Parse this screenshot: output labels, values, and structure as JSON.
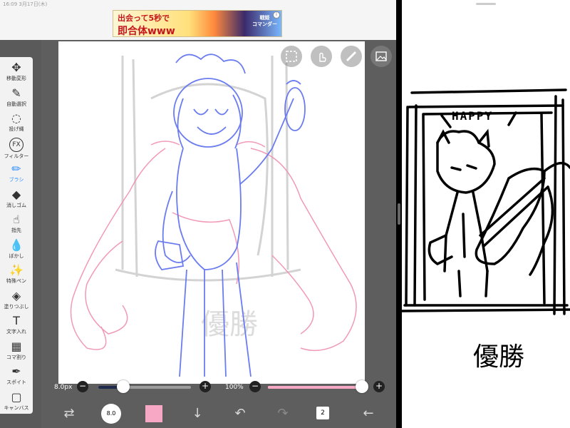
{
  "statusbar": {
    "time": "16:09  3月17日(木)"
  },
  "ad": {
    "line1": "出会って5秒で",
    "line2": "即合体www",
    "logo": "戦姫\nコマンダー",
    "info": "i"
  },
  "toolbar": {
    "items": [
      {
        "label": "移動変形",
        "icon": "move-icon",
        "glyph": "✥"
      },
      {
        "label": "自動選択",
        "icon": "magic-wand-icon",
        "glyph": "✎"
      },
      {
        "label": "投げ縄",
        "icon": "lasso-icon",
        "glyph": "◌"
      },
      {
        "label": "フィルター",
        "icon": "filter-icon",
        "glyph": "FX"
      },
      {
        "label": "ブラシ",
        "icon": "brush-icon",
        "glyph": "✏"
      },
      {
        "label": "消しゴム",
        "icon": "eraser-icon",
        "glyph": "◆"
      },
      {
        "label": "指先",
        "icon": "finger-icon",
        "glyph": "☝"
      },
      {
        "label": "ぼかし",
        "icon": "blur-icon",
        "glyph": "💧"
      },
      {
        "label": "特殊ペン",
        "icon": "special-pen-icon",
        "glyph": "✨"
      },
      {
        "label": "塗りつぶし",
        "icon": "fill-icon",
        "glyph": "◈"
      },
      {
        "label": "文字入れ",
        "icon": "text-icon",
        "glyph": "T"
      },
      {
        "label": "コマ割り",
        "icon": "frame-divider-icon",
        "glyph": "▦"
      },
      {
        "label": "スポイト",
        "icon": "eyedropper-icon",
        "glyph": "✒"
      },
      {
        "label": "キャンバス",
        "icon": "canvas-icon",
        "glyph": "▢"
      }
    ],
    "active": "ブラシ"
  },
  "sliders": {
    "brush_size": "8.0px",
    "opacity": "100%",
    "size_fraction": 0.27,
    "opacity_fraction": 1.0
  },
  "bottom_bar": {
    "layer_count": "2",
    "brush_badge": "8.0"
  },
  "colors": {
    "current": "#f7a8c4",
    "accent": "#2f8fff",
    "sketch_blue": "#6b7cf0",
    "sketch_pink": "#f08fb0"
  },
  "right_sketch": {
    "happy": "HAPPY",
    "caption": "優勝"
  },
  "canvas_sketch": {
    "watermark": "優勝"
  }
}
